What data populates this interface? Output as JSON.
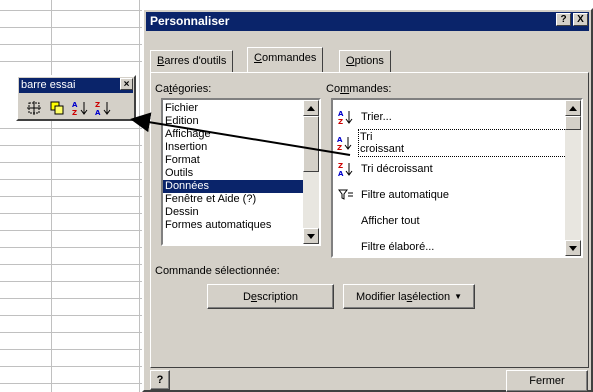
{
  "toolbar": {
    "title": "barre essai",
    "buttons": [
      {
        "icon": "select-objects-icon"
      },
      {
        "icon": "copy-objects-icon"
      },
      {
        "icon": "sort-ascending-icon"
      },
      {
        "icon": "sort-descending-icon"
      }
    ]
  },
  "dialog": {
    "title": "Personnaliser",
    "help_btn": "?",
    "close_btn": "X",
    "tabs": [
      {
        "label": "Barres d'outils",
        "mnemonic": "B",
        "rest": "arres d'outils"
      },
      {
        "label": "Commandes",
        "mnemonic": "C",
        "rest": "ommandes"
      },
      {
        "label": "Options",
        "mnemonic": "O",
        "rest": "ptions"
      }
    ],
    "categories_label": {
      "pre": "Ca",
      "mnemonic": "t",
      "post": "égories:"
    },
    "commands_label": {
      "pre": "Co",
      "mnemonic": "m",
      "post": "mandes:"
    },
    "categories": [
      "Fichier",
      "Edition",
      "Affichage",
      "Insertion",
      "Format",
      "Outils",
      "Données",
      "Fenêtre et Aide (?)",
      "Dessin",
      "Formes automatiques"
    ],
    "selected_category": "Données",
    "commands": [
      {
        "icon": "sort-ascending-icon",
        "label": "Trier..."
      },
      {
        "icon": "sort-ascending-icon",
        "label": "Tri croissant"
      },
      {
        "icon": "sort-descending-icon",
        "label": "Tri décroissant"
      },
      {
        "icon": "autofilter-icon",
        "label": "Filtre automatique"
      },
      {
        "icon": "",
        "label": "Afficher tout"
      },
      {
        "icon": "",
        "label": "Filtre élaboré..."
      }
    ],
    "selected_command": "Tri croissant",
    "selected_cmd_label": "Commande sélectionnée:",
    "description_btn": {
      "pre": "D",
      "mnemonic": "e",
      "post": "scription"
    },
    "modify_btn": {
      "pre": "Modifier la ",
      "mnemonic": "s",
      "post": "élection",
      "arrow": "▼"
    },
    "bottom_help": "?",
    "close_label": "Fermer"
  },
  "colors": {
    "titlebar": "#0a246a",
    "face": "#d4d0c8",
    "selection": "#0a246a"
  }
}
